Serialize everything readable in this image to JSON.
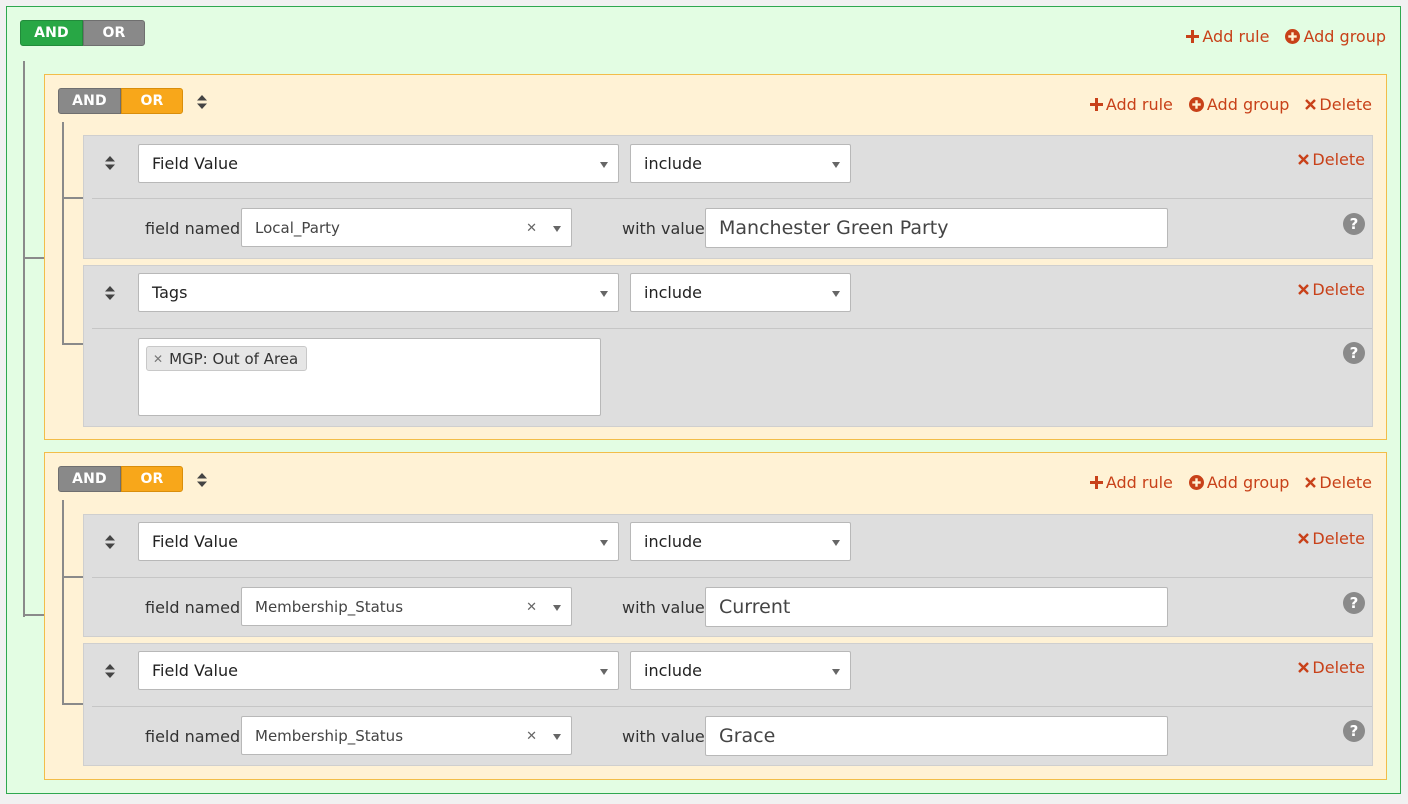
{
  "root": {
    "conditions": {
      "and": "AND",
      "or": "OR",
      "active": "AND"
    },
    "actions": {
      "add_rule": "Add rule",
      "add_group": "Add group"
    }
  },
  "groups": [
    {
      "conditions": {
        "and": "AND",
        "or": "OR",
        "active": "OR"
      },
      "actions": {
        "add_rule": "Add rule",
        "add_group": "Add group",
        "delete": "Delete"
      },
      "rules": [
        {
          "filter": "Field Value",
          "operator": "include",
          "delete": "Delete",
          "field_label": "field named",
          "field": "Local_Party",
          "value_label": "with value",
          "value": "Manchester Green Party"
        },
        {
          "filter": "Tags",
          "operator": "include",
          "delete": "Delete",
          "tags": [
            "MGP: Out of Area"
          ]
        }
      ]
    },
    {
      "conditions": {
        "and": "AND",
        "or": "OR",
        "active": "OR"
      },
      "actions": {
        "add_rule": "Add rule",
        "add_group": "Add group",
        "delete": "Delete"
      },
      "rules": [
        {
          "filter": "Field Value",
          "operator": "include",
          "delete": "Delete",
          "field_label": "field named",
          "field": "Membership_Status",
          "value_label": "with value",
          "value": "Current"
        },
        {
          "filter": "Field Value",
          "operator": "include",
          "delete": "Delete",
          "field_label": "field named",
          "field": "Membership_Status",
          "value_label": "with value",
          "value": "Grace"
        }
      ]
    }
  ],
  "help_symbol": "?",
  "colors": {
    "root_bg": "#e3fde3",
    "root_border": "#2fa84f",
    "group_bg": "#fff2d5",
    "group_border": "#f2bd49",
    "and_active": "#28a745",
    "or_active": "#f8a71a",
    "inactive": "#898989",
    "action": "#c84119",
    "rule_bg": "#dedede"
  },
  "icons": [
    "plus-icon",
    "plus-circle-icon",
    "times-icon",
    "sort-icon",
    "clear-icon",
    "chevron-down-icon",
    "help-icon"
  ]
}
